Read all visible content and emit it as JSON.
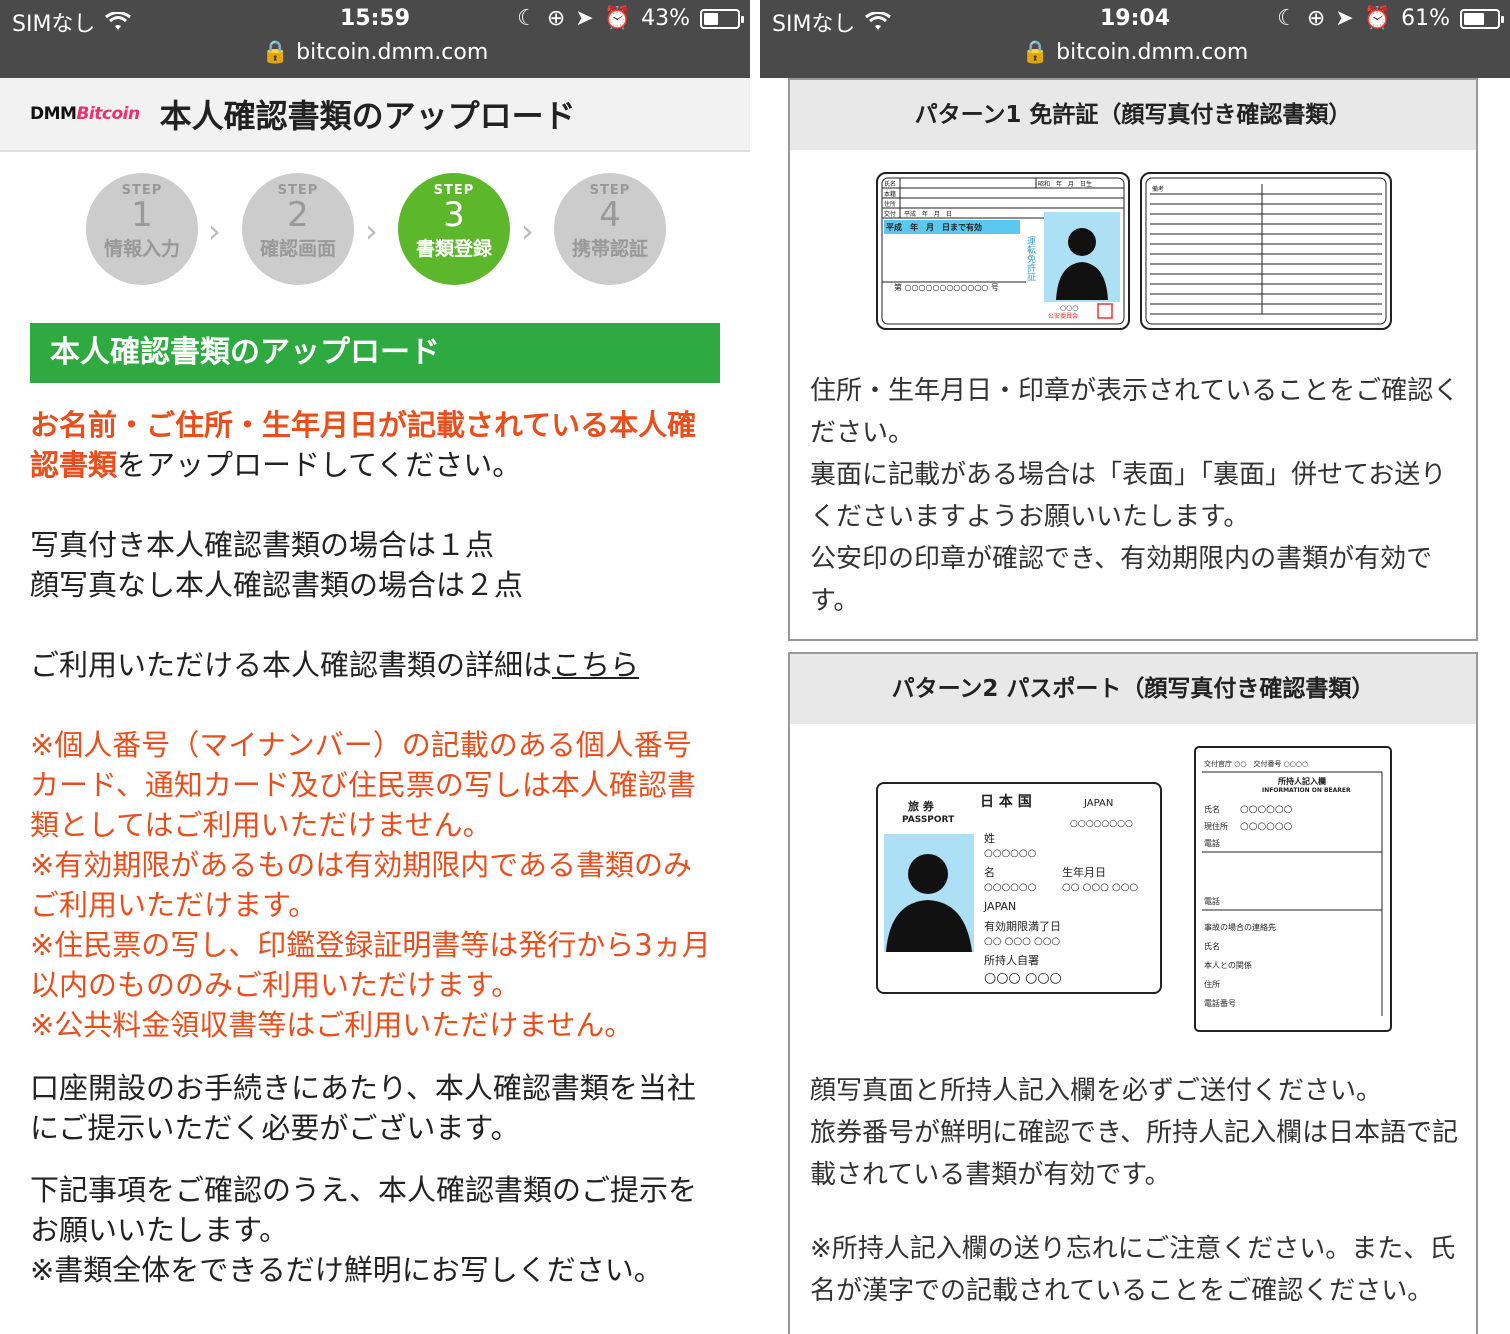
{
  "left": {
    "status": {
      "carrier": "SIMなし",
      "time": "15:59",
      "battery": "43%",
      "battery_level": 0.43,
      "url": "bitcoin.dmm.com"
    },
    "header": {
      "logo_dmm": "DMM",
      "logo_bitcoin": "Bitcoin",
      "title": "本人確認書類のアップロード"
    },
    "steps": [
      {
        "word": "STEP",
        "num": "1",
        "label": "情報入力",
        "active": false
      },
      {
        "word": "STEP",
        "num": "2",
        "label": "確認画面",
        "active": false
      },
      {
        "word": "STEP",
        "num": "3",
        "label": "書類登録",
        "active": true
      },
      {
        "word": "STEP",
        "num": "4",
        "label": "携帯認証",
        "active": false
      }
    ],
    "section_title": "本人確認書類のアップロード",
    "intro_bold": "お名前・ご住所・生年月日が記載されている本人確認書類",
    "intro_rest": "をアップロードしてください。",
    "count_line1": "写真付き本人確認書類の場合は１点",
    "count_line2": "顔写真なし本人確認書類の場合は２点",
    "details_text": "ご利用いただける本人確認書類の詳細は",
    "details_link": "こちら",
    "notes": [
      "※個人番号（マイナンバー）の記載のある個人番号カード、通知カード及び住民票の写しは本人確認書類としてはご利用いただけません。",
      "※有効期限があるものは有効期限内である書類のみご利用いただけます。",
      "※住民票の写し、印鑑登録証明書等は発行から3ヵ月以内のもののみご利用いただけます。",
      "※公共料金領収書等はご利用いただけません。"
    ],
    "account_text": "口座開設のお手続きにあたり、本人確認書類を当社にご提示いただく必要がございます。",
    "confirm_text": "下記事項をご確認のうえ、本人確認書類のご提示をお願いいたします。",
    "photo_note": "※書類全体をできるだけ鮮明にお写しください。"
  },
  "right": {
    "status": {
      "carrier": "SIMなし",
      "time": "19:04",
      "battery": "61%",
      "battery_level": 0.61,
      "url": "bitcoin.dmm.com"
    },
    "pattern1": {
      "title": "パターン1 免許証（顔写真付き確認書類）",
      "license_front": {
        "fields": [
          "氏名",
          "本籍",
          "住所",
          "交付"
        ],
        "era_date": "昭和　年　月　日生",
        "issue_date": "平成　年　月　日",
        "validity": "平成　年　月　日まで有効",
        "number": "第 ○○○○○○○○○○○○ 号",
        "vertical_text": "運転免許証",
        "issuer_code": "○○○",
        "issuer": "公安委員会"
      },
      "license_back_label": "備考",
      "text1": "住所・生年月日・印章が表示されていることをご確認ください。",
      "text2": "裏面に記載がある場合は「表面」「裏面」併せてお送りくださいますようお願いいたします。",
      "text3": "公安印の印章が確認でき、有効期限内の書類が有効です。"
    },
    "pattern2": {
      "title": "パターン2 パスポート（顔写真付き確認書類）",
      "passport": {
        "type_ja": "旅 券",
        "type_en": "PASSPORT",
        "country_ja": "日 本 国",
        "country_en": "JAPAN",
        "number": "○○○○○○○○",
        "surname_label": "姓",
        "surname": "○○○○○○",
        "given_label": "名",
        "given": "○○○○○○",
        "birth_label": "生年月日",
        "birth": "○○ ○○○ ○○○",
        "nationality": "JAPAN",
        "expiry_label": "有効期限満了日",
        "expiry": "○○ ○○○ ○○○",
        "signature_label": "所持人自署",
        "signature": "○○○ ○○○"
      },
      "passport_back": {
        "issuer_line": "交付官庁 ○○　交付番号 ○○○○",
        "title_ja": "所持人記入欄",
        "title_en": "INFORMATION ON BEARER",
        "name_label": "氏名",
        "name": "○○○○○○",
        "address_label": "現住所",
        "address": "○○○○○○",
        "phone_label": "電話",
        "phone2_label": "電話",
        "emergency_label": "事故の場合の連絡先",
        "emergency_name": "氏名",
        "relation": "本人との関係",
        "emergency_address": "住所",
        "emergency_phone": "電話番号"
      },
      "text1": "顔写真面と所持人記入欄を必ずご送付ください。",
      "text2": "旅券番号が鮮明に確認でき、所持人記入欄は日本語で記載されている書類が有効です。",
      "note": "※所持人記入欄の送り忘れにご注意ください。また、氏名が漢字での記載されていることをご確認ください。"
    }
  },
  "colors": {
    "accent_green": "#2eaa40",
    "step_active": "#5cb82a",
    "notice_orange": "#e84f1c",
    "status_bar": "#4a4a4a"
  }
}
